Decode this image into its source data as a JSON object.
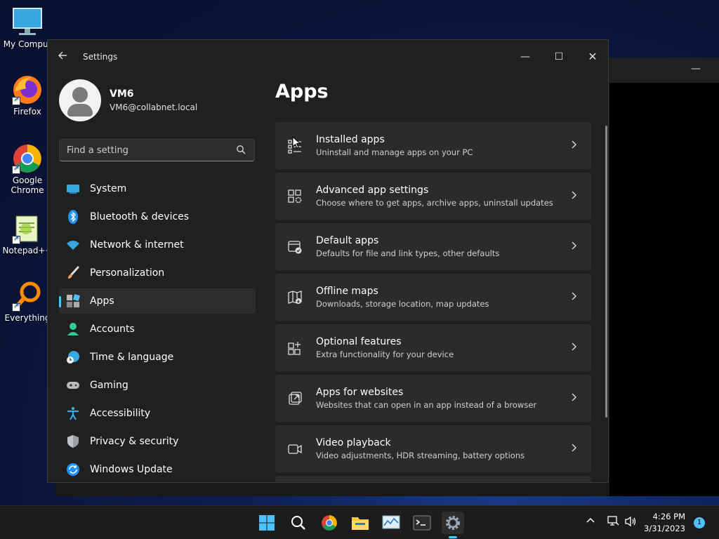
{
  "desktop": {
    "icons": [
      {
        "label": "My Comput",
        "icon": "monitor-icon"
      },
      {
        "label": "Firefox",
        "icon": "firefox-icon"
      },
      {
        "label": "Google Chrome",
        "icon": "chrome-icon"
      },
      {
        "label": "Notepad++",
        "icon": "notepadpp-icon"
      },
      {
        "label": "Everything",
        "icon": "everything-search-icon"
      }
    ]
  },
  "window": {
    "title": "Settings",
    "controls": {
      "minimize": "—",
      "maximize": "☐",
      "close": "✕"
    }
  },
  "user": {
    "name": "VM6",
    "email": "VM6@collabnet.local"
  },
  "search": {
    "placeholder": "Find a setting"
  },
  "nav": {
    "items": [
      {
        "label": "System",
        "icon": "system-display-icon"
      },
      {
        "label": "Bluetooth & devices",
        "icon": "bluetooth-icon"
      },
      {
        "label": "Network & internet",
        "icon": "wifi-icon"
      },
      {
        "label": "Personalization",
        "icon": "brush-icon"
      },
      {
        "label": "Apps",
        "icon": "apps-icon"
      },
      {
        "label": "Accounts",
        "icon": "accounts-icon"
      },
      {
        "label": "Time & language",
        "icon": "clock-globe-icon"
      },
      {
        "label": "Gaming",
        "icon": "gamepad-icon"
      },
      {
        "label": "Accessibility",
        "icon": "accessibility-icon"
      },
      {
        "label": "Privacy & security",
        "icon": "shield-icon"
      },
      {
        "label": "Windows Update",
        "icon": "update-icon"
      }
    ],
    "active": "Apps"
  },
  "page": {
    "title": "Apps",
    "cards": [
      {
        "title": "Installed apps",
        "subtitle": "Uninstall and manage apps on your PC",
        "icon": "installed-apps-icon"
      },
      {
        "title": "Advanced app settings",
        "subtitle": "Choose where to get apps, archive apps, uninstall updates",
        "icon": "advanced-settings-icon"
      },
      {
        "title": "Default apps",
        "subtitle": "Defaults for file and link types, other defaults",
        "icon": "default-apps-icon"
      },
      {
        "title": "Offline maps",
        "subtitle": "Downloads, storage location, map updates",
        "icon": "map-icon"
      },
      {
        "title": "Optional features",
        "subtitle": "Extra functionality for your device",
        "icon": "optional-features-icon"
      },
      {
        "title": "Apps for websites",
        "subtitle": "Websites that can open in an app instead of a browser",
        "icon": "web-link-icon"
      },
      {
        "title": "Video playback",
        "subtitle": "Video adjustments, HDR streaming, battery options",
        "icon": "video-icon"
      }
    ]
  },
  "taskbar": {
    "apps": [
      "windows-start-icon",
      "search-icon",
      "chrome-icon",
      "file-explorer-icon",
      "resource-monitor-icon",
      "terminal-icon",
      "settings-gear-icon"
    ],
    "clock_time": "4:26 PM",
    "clock_date": "3/31/2023",
    "notification_count": "1"
  },
  "colors": {
    "accent": "#4cc2ff",
    "window_bg": "#202020",
    "card_bg": "#2b2b2b"
  }
}
